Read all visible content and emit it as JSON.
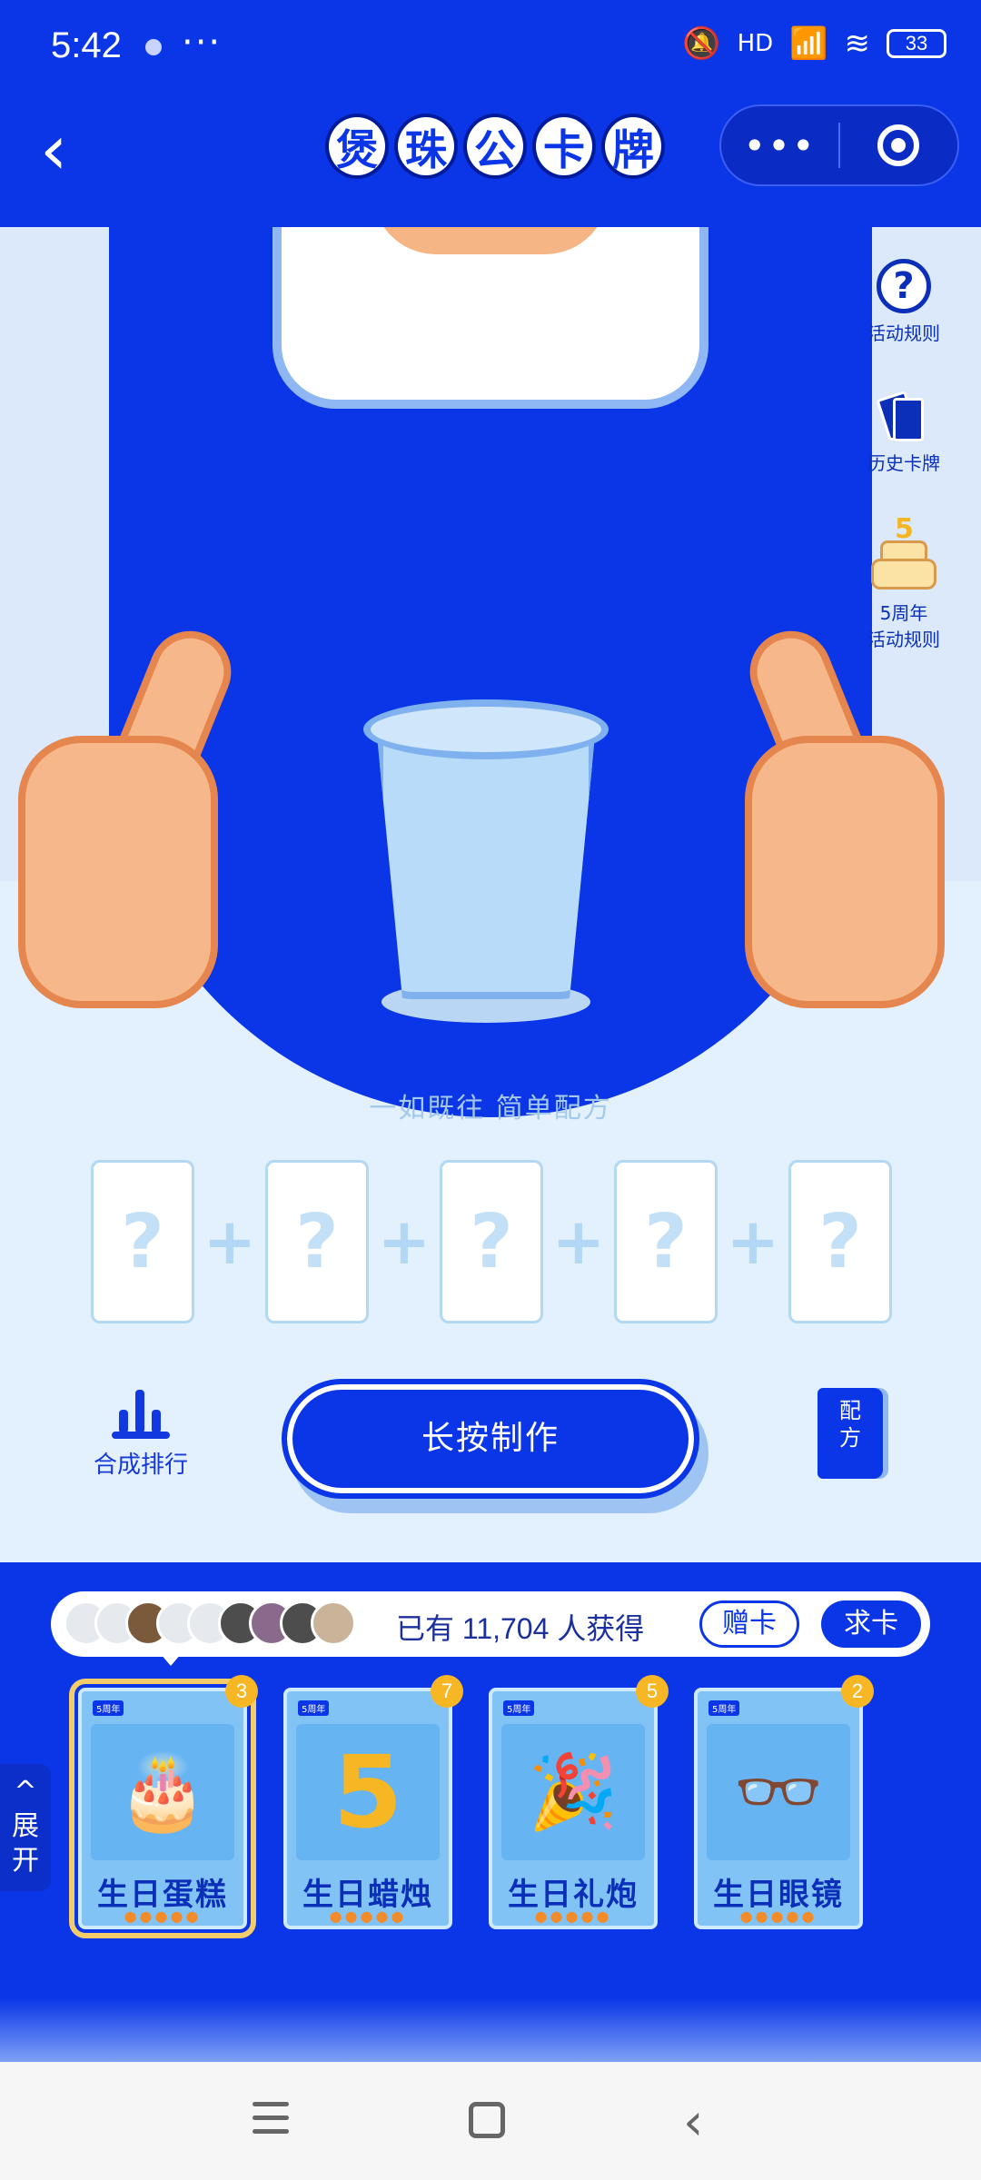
{
  "status_bar": {
    "time": "5:42",
    "more": "···",
    "network": "HD",
    "battery": "33",
    "icons": [
      "notification-dot-icon",
      "mute-icon",
      "signal-icon",
      "wifi-icon",
      "battery-icon"
    ]
  },
  "header": {
    "title_chars": [
      "煲",
      "珠",
      "公",
      "卡",
      "牌"
    ],
    "back_icon": "back-arrow-icon",
    "menu_label": "•••",
    "close_icon": "target-circle-icon"
  },
  "side_buttons": {
    "rules": "活动规则",
    "history": "历史卡牌",
    "anniversary_line1": "5周年",
    "anniversary_line2": "活动规则"
  },
  "scene": {
    "tagline": "一如既往 简单配方"
  },
  "slots": {
    "placeholder": "?",
    "plus": "+"
  },
  "actions": {
    "rank_label": "合成排行",
    "make_button": "长按制作",
    "recipe_line1": "配",
    "recipe_line2": "方"
  },
  "pill": {
    "text": "已有 11,704 人获得",
    "give": "赠卡",
    "ask": "求卡"
  },
  "expand": {
    "arrow": "^",
    "char1": "展",
    "char2": "开"
  },
  "cards": [
    {
      "name": "生日蛋糕",
      "count": "3",
      "tag": "5周年",
      "art": "🎂",
      "selected": true
    },
    {
      "name": "生日蜡烛",
      "count": "7",
      "tag": "5周年",
      "art": "5",
      "selected": false
    },
    {
      "name": "生日礼炮",
      "count": "5",
      "tag": "5周年",
      "art": "🎉",
      "selected": false
    },
    {
      "name": "生日眼镜",
      "count": "2",
      "tag": "5周年",
      "art": "👓",
      "selected": false
    }
  ],
  "card_dots": "●●●●●",
  "colors": {
    "brand_blue": "#0a36e8",
    "light_bg": "#e2f1fd",
    "badge_yellow": "#f7b623"
  }
}
